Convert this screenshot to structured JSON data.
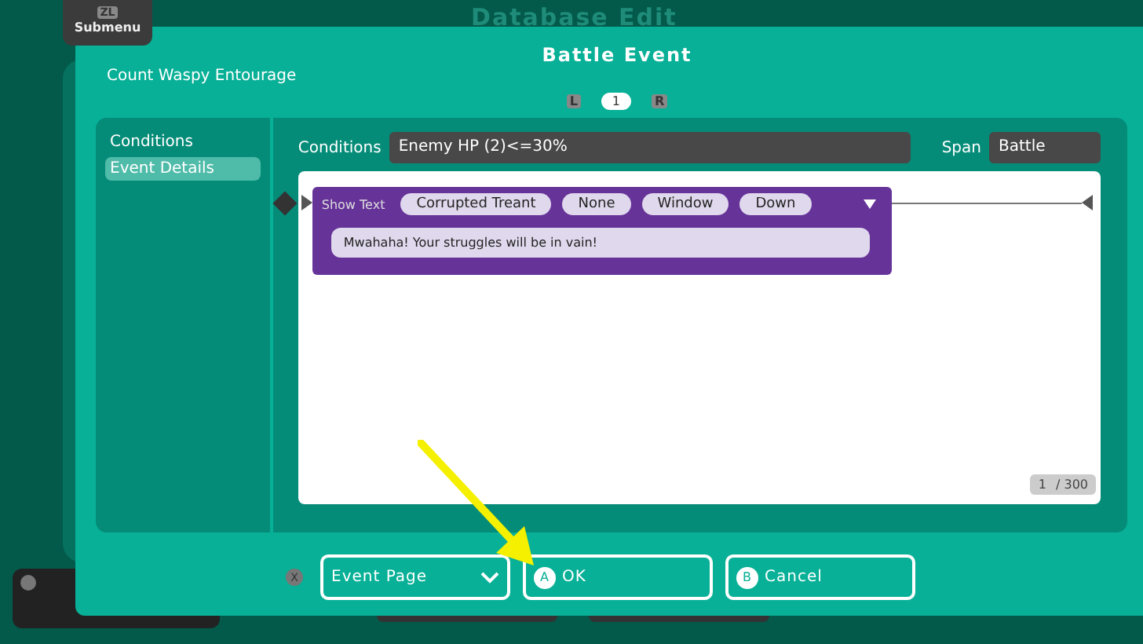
{
  "background": {
    "title": "Database Edit",
    "submenu": {
      "key": "ZL",
      "label": "Submenu"
    }
  },
  "dialog": {
    "title": "Battle Event",
    "subtitle": "Count Waspy Entourage",
    "pager": {
      "prev": "L",
      "page": "1",
      "next": "R"
    },
    "sidebar": {
      "items": [
        {
          "label": "Conditions",
          "selected": false
        },
        {
          "label": "Event Details",
          "selected": true
        }
      ]
    },
    "conditions": {
      "label": "Conditions",
      "value": "Enemy HP (2)<=30%"
    },
    "span": {
      "label": "Span",
      "value": "Battle"
    },
    "event": {
      "command": "Show Text",
      "params": [
        "Corrupted Treant",
        "None",
        "Window",
        "Down"
      ],
      "text": "Mwahaha! Your struggles will be in vain!"
    },
    "counter": {
      "current": "1",
      "total": "/ 300"
    },
    "footer": {
      "key": "X",
      "dropdown": "Event Page",
      "buttons": [
        {
          "key": "A",
          "label": "OK"
        },
        {
          "key": "B",
          "label": "Cancel"
        }
      ]
    }
  }
}
